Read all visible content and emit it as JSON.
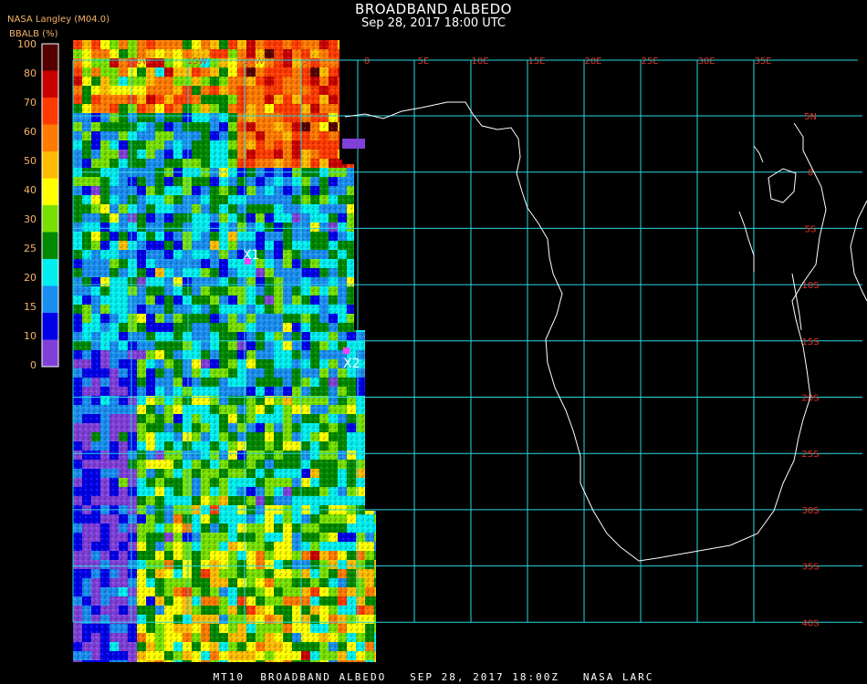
{
  "header": {
    "title": "BROADBAND ALBEDO",
    "subtitle": "Sep 28, 2017 18:00 UTC",
    "producer": "NASA Langley (M04.0)"
  },
  "legend": {
    "title": "BBALB (%)",
    "ticks": [
      "100",
      "80",
      "70",
      "60",
      "50",
      "40",
      "30",
      "25",
      "20",
      "15",
      "10",
      "0"
    ],
    "colors": [
      "#550000",
      "#c80000",
      "#ff3a00",
      "#ff7a00",
      "#ffbb00",
      "#ffff00",
      "#77e000",
      "#008800",
      "#00eeee",
      "#1a8ef0",
      "#0000e8",
      "#8040d8"
    ]
  },
  "map": {
    "grid_color": "#2ad8e0",
    "label_color": "#e8332a",
    "lon_labels": [
      "20W",
      "15W",
      "10W",
      "5W",
      "0",
      "5E",
      "10E",
      "15E",
      "20E",
      "25E",
      "30E",
      "35E"
    ],
    "lat_labels": [
      "5N",
      "0",
      "5S",
      "10S",
      "15S",
      "20S",
      "25S",
      "30S",
      "35S",
      "40S"
    ],
    "markers": [
      {
        "label": "X1",
        "color": "#ff40ff"
      },
      {
        "label": "X2",
        "color": "#ff40ff"
      }
    ]
  },
  "footer": {
    "text": "MT10  BROADBAND ALBEDO   SEP 28, 2017 18:00Z   NASA LARC"
  }
}
